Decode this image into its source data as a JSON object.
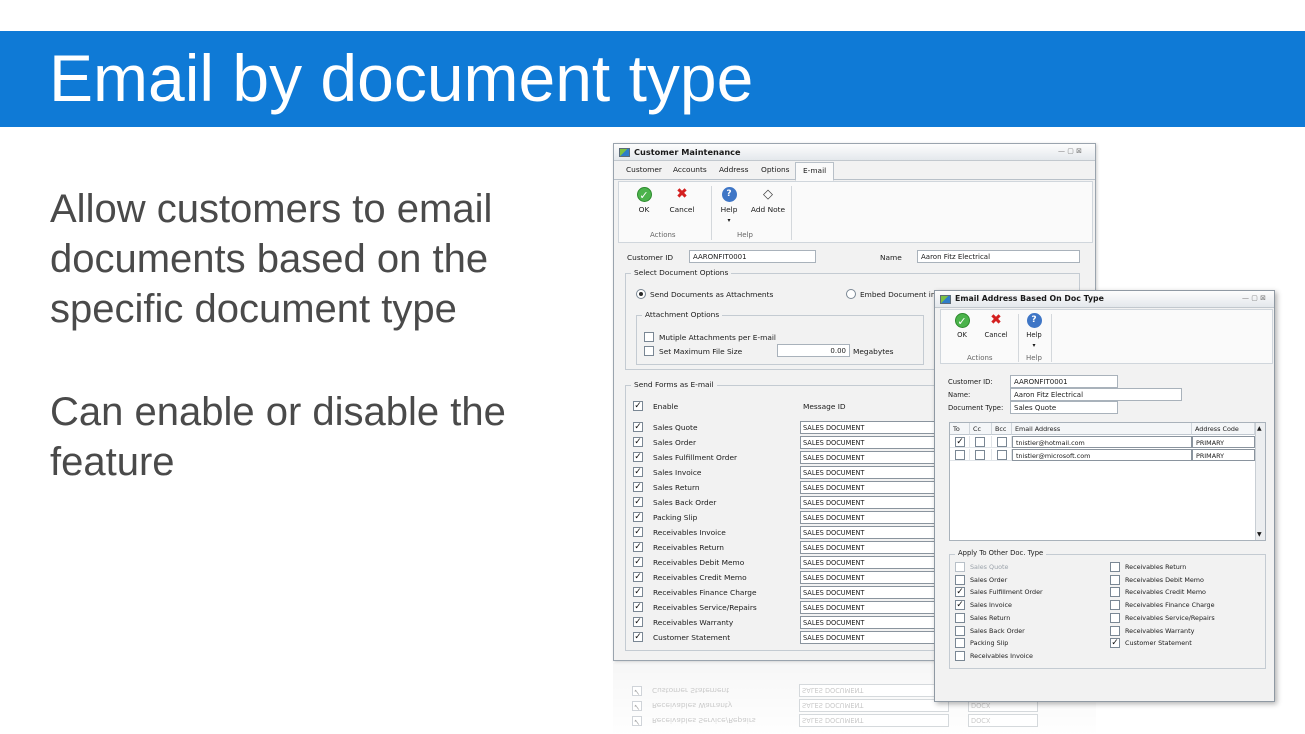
{
  "slide": {
    "title": "Email by document type",
    "bullets": [
      "Allow customers to email documents based on the specific document type",
      "Can enable or disable the feature"
    ]
  },
  "customer_window": {
    "title": "Customer Maintenance",
    "window_controls": "— ▢ ⊠",
    "tabs": [
      "Customer",
      "Accounts",
      "Address",
      "Options",
      "E-mail"
    ],
    "active_tab": "E-mail",
    "ribbon": {
      "ok": "OK",
      "cancel": "Cancel",
      "help": "Help",
      "add_note": "Add Note",
      "group_actions": "Actions",
      "group_help": "Help",
      "dropdown": "▾"
    },
    "customer_id_label": "Customer ID",
    "customer_id": "AARONFIT0001",
    "name_label": "Name",
    "name": "Aaron Fitz Electrical",
    "select_doc_options": "Select Document Options",
    "send_as_attachments": "Send Documents as Attachments",
    "embed_document": "Embed Document in M",
    "attachment_options": "Attachment Options",
    "multiple_attachments": "Mutiple Attachments per E-mail",
    "set_max_file_size": "Set Maximum File Size",
    "max_file_size": "0.00",
    "megabytes": "Megabytes",
    "send_forms_title": "Send Forms as E-mail",
    "col_enable": "Enable",
    "col_message_id": "Message ID",
    "check_mark": "✓",
    "forms": [
      {
        "name": "Sales Quote",
        "message": "SALES DOCUMENT"
      },
      {
        "name": "Sales Order",
        "message": "SALES DOCUMENT"
      },
      {
        "name": "Sales Fulfillment Order",
        "message": "SALES DOCUMENT"
      },
      {
        "name": "Sales Invoice",
        "message": "SALES DOCUMENT"
      },
      {
        "name": "Sales Return",
        "message": "SALES DOCUMENT"
      },
      {
        "name": "Sales Back Order",
        "message": "SALES DOCUMENT"
      },
      {
        "name": "Packing Slip",
        "message": "SALES DOCUMENT"
      },
      {
        "name": "Receivables Invoice",
        "message": "SALES DOCUMENT"
      },
      {
        "name": "Receivables Return",
        "message": "SALES DOCUMENT"
      },
      {
        "name": "Receivables Debit Memo",
        "message": "SALES DOCUMENT"
      },
      {
        "name": "Receivables Credit Memo",
        "message": "SALES DOCUMENT"
      },
      {
        "name": "Receivables Finance Charge",
        "message": "SALES DOCUMENT"
      },
      {
        "name": "Receivables Service/Repairs",
        "message": "SALES DOCUMENT"
      },
      {
        "name": "Receivables Warranty",
        "message": "SALES DOCUMENT"
      },
      {
        "name": "Customer Statement",
        "message": "SALES DOCUMENT"
      }
    ],
    "reflection": {
      "rows": [
        "Customer Statement",
        "Receivables Warranty",
        "Receivables Service/Repairs"
      ],
      "message": "SALES DOCUMENT",
      "docx": "DOCX"
    }
  },
  "email_dialog": {
    "title": "Email Address Based On Doc Type",
    "window_controls": "— ▢ ⊠",
    "ribbon": {
      "ok": "OK",
      "cancel": "Cancel",
      "help": "Help",
      "group_actions": "Actions",
      "group_help": "Help",
      "dropdown": "▾"
    },
    "customer_id_label": "Customer ID:",
    "customer_id": "AARONFIT0001",
    "name_label": "Name:",
    "name": "Aaron Fitz Electrical",
    "doc_type_label": "Document Type:",
    "doc_type": "Sales Quote",
    "grid_headers": [
      "To",
      "Cc",
      "Bcc",
      "Email Address",
      "Address Code"
    ],
    "grid_rows": [
      {
        "to": true,
        "cc": false,
        "bcc": false,
        "email": "tnistler@hotmail.com",
        "code": "PRIMARY"
      },
      {
        "to": false,
        "cc": false,
        "bcc": false,
        "email": "tnistler@microsoft.com",
        "code": "PRIMARY"
      }
    ],
    "scroll_up": "▲",
    "scroll_down": "▼",
    "apply_title": "Apply To Other Doc. Type",
    "apply_left": [
      {
        "label": "Sales Quote",
        "checked": false,
        "disabled": true
      },
      {
        "label": "Sales Order",
        "checked": false,
        "disabled": false
      },
      {
        "label": "Sales Fulfillment Order",
        "checked": true,
        "disabled": false
      },
      {
        "label": "Sales Invoice",
        "checked": true,
        "disabled": false
      },
      {
        "label": "Sales Return",
        "checked": false,
        "disabled": false
      },
      {
        "label": "Sales Back Order",
        "checked": false,
        "disabled": false
      },
      {
        "label": "Packing Slip",
        "checked": false,
        "disabled": false
      },
      {
        "label": "Receivables Invoice",
        "checked": false,
        "disabled": false
      }
    ],
    "apply_right": [
      {
        "label": "Receivables Return",
        "checked": false
      },
      {
        "label": "Receivables Debit Memo",
        "checked": false
      },
      {
        "label": "Receivables Credit Memo",
        "checked": false
      },
      {
        "label": "Receivables Finance Charge",
        "checked": false
      },
      {
        "label": "Receivables Service/Repairs",
        "checked": false
      },
      {
        "label": "Receivables Warranty",
        "checked": false
      },
      {
        "label": "Customer Statement",
        "checked": true
      }
    ]
  }
}
